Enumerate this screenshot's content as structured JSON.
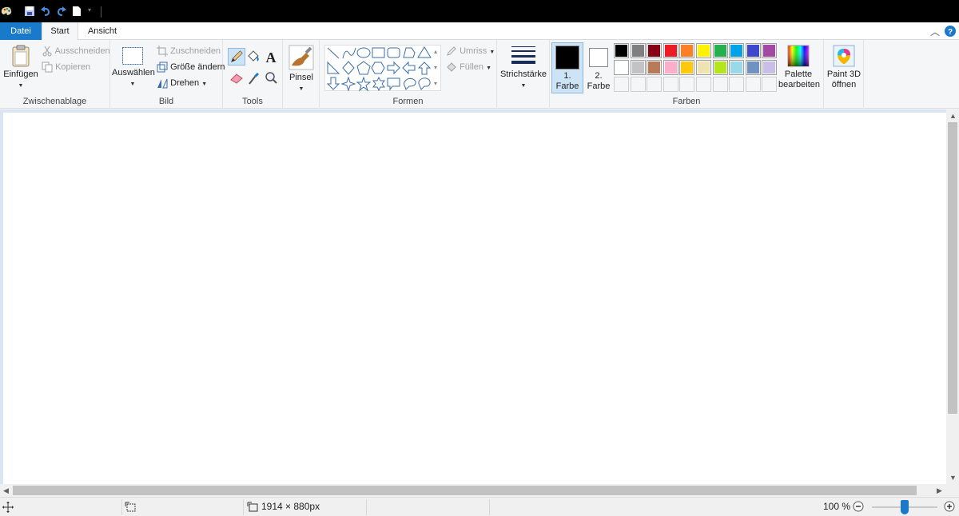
{
  "tabs": {
    "file": "Datei",
    "start": "Start",
    "view": "Ansicht"
  },
  "clipboard": {
    "paste": "Einfügen",
    "cut": "Ausschneiden",
    "copy": "Kopieren",
    "group": "Zwischenablage"
  },
  "image": {
    "select": "Auswählen",
    "crop": "Zuschneiden",
    "resize": "Größe ändern",
    "rotate": "Drehen",
    "group": "Bild"
  },
  "tools": {
    "group": "Tools"
  },
  "brushes": {
    "label": "Pinsel"
  },
  "shapes": {
    "outline": "Umriss",
    "fill": "Füllen",
    "group": "Formen"
  },
  "stroke": {
    "label": "Strichstärke"
  },
  "colors": {
    "color1_line1": "1.",
    "color1_line2": "Farbe",
    "color2_line1": "2.",
    "color2_line2": "Farbe",
    "edit_line1": "Palette",
    "edit_line2": "bearbeiten",
    "group": "Farben",
    "color1_value": "#000000",
    "color2_value": "#ffffff",
    "row1": [
      "#000000",
      "#7f7f7f",
      "#880015",
      "#ed1c24",
      "#ff7f27",
      "#fff200",
      "#22b14c",
      "#00a2e8",
      "#3f48cc",
      "#a349a4"
    ],
    "row2": [
      "#ffffff",
      "#c3c3c3",
      "#b97a57",
      "#ffaec9",
      "#ffc90e",
      "#efe4b0",
      "#b5e61d",
      "#99d9ea",
      "#7092be",
      "#c8bfe7"
    ]
  },
  "paint3d": {
    "line1": "Paint 3D",
    "line2": "öffnen"
  },
  "status": {
    "size": "1914 × 880px",
    "zoom": "100 %",
    "zoom_fraction": 0.5
  }
}
